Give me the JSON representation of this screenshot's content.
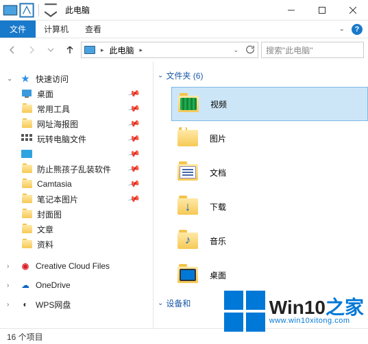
{
  "titlebar": {
    "title": "此电脑"
  },
  "ribbon": {
    "file": "文件",
    "tabs": [
      "计算机",
      "查看"
    ]
  },
  "nav": {
    "breadcrumb": "此电脑",
    "search_placeholder": "搜索\"此电脑\""
  },
  "tree": {
    "quick_access": "快速访问",
    "items": [
      {
        "label": "桌面",
        "pinned": true
      },
      {
        "label": "常用工具",
        "pinned": true
      },
      {
        "label": "网址海报图",
        "pinned": true
      },
      {
        "label": "玩转电脑文件",
        "pinned": true,
        "special": "grid"
      },
      {
        "label": "",
        "pinned": true,
        "special": "blue"
      },
      {
        "label": "防止熊孩子乱装软件",
        "pinned": true
      },
      {
        "label": "Camtasia",
        "pinned": true
      },
      {
        "label": "笔记本图片",
        "pinned": true
      },
      {
        "label": "封面图",
        "pinned": true
      },
      {
        "label": "文章",
        "pinned": true
      },
      {
        "label": "资料",
        "pinned": true
      }
    ],
    "creative": "Creative Cloud Files",
    "onedrive": "OneDrive",
    "wps": "WPS网盘"
  },
  "main": {
    "group_folders": {
      "label": "文件夹",
      "count": 6
    },
    "folders": [
      {
        "label": "视频",
        "kind": "video",
        "selected": true
      },
      {
        "label": "图片",
        "kind": "pic"
      },
      {
        "label": "文档",
        "kind": "doc"
      },
      {
        "label": "下载",
        "kind": "down"
      },
      {
        "label": "音乐",
        "kind": "music"
      },
      {
        "label": "桌面",
        "kind": "desk"
      }
    ],
    "group_devices": "设备和"
  },
  "status": {
    "items": "16 个项目"
  },
  "watermark": {
    "brand1": "Win10",
    "brand2": "之家",
    "url": "www.win10xitong.com"
  }
}
